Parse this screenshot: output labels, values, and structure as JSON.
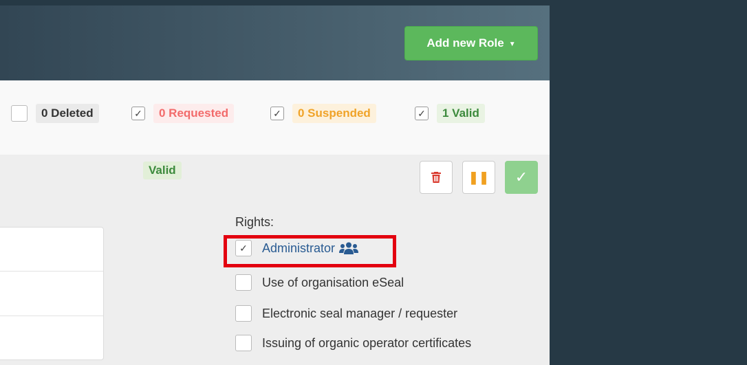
{
  "header": {
    "add_role_label": "Add new Role"
  },
  "filters": [
    {
      "label": "0 Deleted",
      "checked": false
    },
    {
      "label": "0 Requested",
      "checked": true
    },
    {
      "label": "0 Suspended",
      "checked": true
    },
    {
      "label": "1 Valid",
      "checked": true
    }
  ],
  "role": {
    "status": "Valid",
    "rights_title": "Rights:",
    "rights": [
      {
        "label": "Administrator",
        "checked": true,
        "icon": "users-icon"
      },
      {
        "label": "Use of organisation eSeal",
        "checked": false
      },
      {
        "label": "Electronic seal manager / requester",
        "checked": false
      },
      {
        "label": "Issuing of organic operator certificates",
        "checked": false
      }
    ]
  },
  "colors": {
    "success": "#5cb85c",
    "danger": "#d9372b",
    "warning": "#f0a328",
    "highlight": "#e3000f",
    "link": "#295b92"
  }
}
